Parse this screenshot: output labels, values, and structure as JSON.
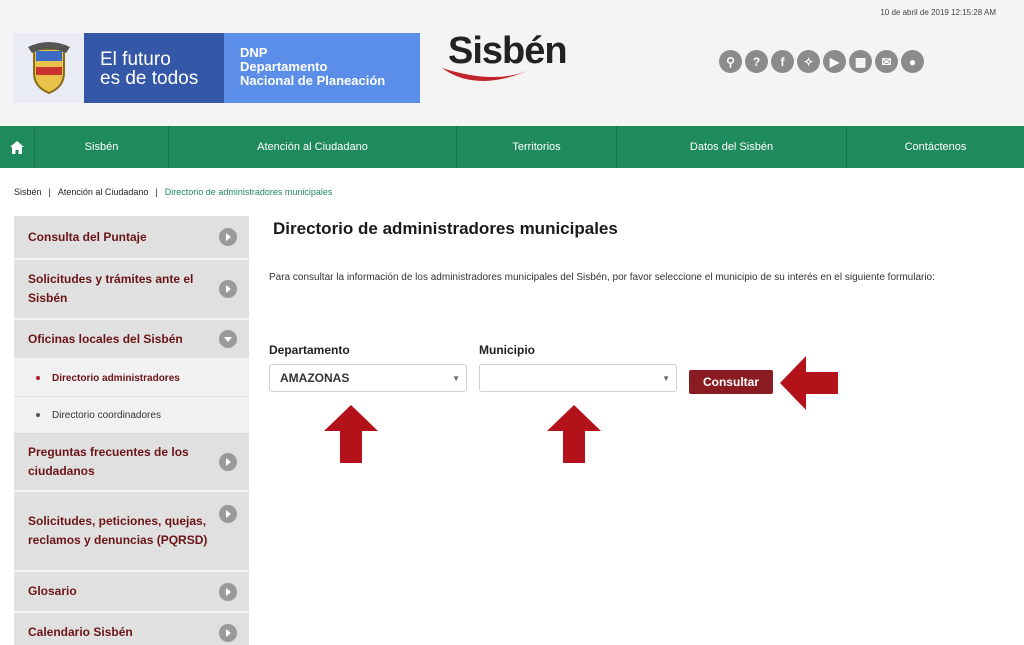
{
  "header": {
    "timestamp": "10 de abril de 2019 12:15:28 AM",
    "gov_slogan_line1": "El futuro",
    "gov_slogan_line2": "es de todos",
    "dnp_abbr": "DNP",
    "dnp_line1": "Departamento",
    "dnp_line2": "Nacional de Planeación",
    "site_logo": "Sisbén",
    "social_icons": [
      "search-icon",
      "help-icon",
      "facebook-icon",
      "twitter-icon",
      "youtube-icon",
      "sitemap-icon",
      "mail-icon",
      "community-icon"
    ]
  },
  "nav": {
    "items": [
      "Sisbén",
      "Atención al Ciudadano",
      "Territorios",
      "Datos del Sisbén",
      "Contáctenos"
    ]
  },
  "breadcrumb": {
    "level1": "Sisbén",
    "level2": "Atención al Ciudadano",
    "current": "Directorio de administradores municipales"
  },
  "sidebar": {
    "items": [
      "Consulta del Puntaje",
      "Solicitudes y trámites ante el Sisbén",
      "Oficinas locales del Sisbén",
      "Preguntas frecuentes de los ciudadanos",
      "Solicitudes, peticiones, quejas, reclamos y denuncias (PQRSD)",
      "Glosario",
      "Calendario Sisbén"
    ],
    "subitems": [
      "Directorio administradores",
      "Directorio coordinadores"
    ]
  },
  "main": {
    "title": "Directorio de administradores municipales",
    "intro": "Para consultar la información de los administradores municipales del Sisbén, por favor seleccione el municipio de su interés en el siguiente formulario:",
    "departamento_label": "Departamento",
    "departamento_value": "AMAZONAS",
    "municipio_label": "Municipio",
    "municipio_value": "",
    "submit_label": "Consultar"
  },
  "colors": {
    "nav_green": "#1f8a5c",
    "button_red": "#8a1b22",
    "sidebar_text": "#6b1416",
    "annotation_arrow": "#b3121b"
  }
}
